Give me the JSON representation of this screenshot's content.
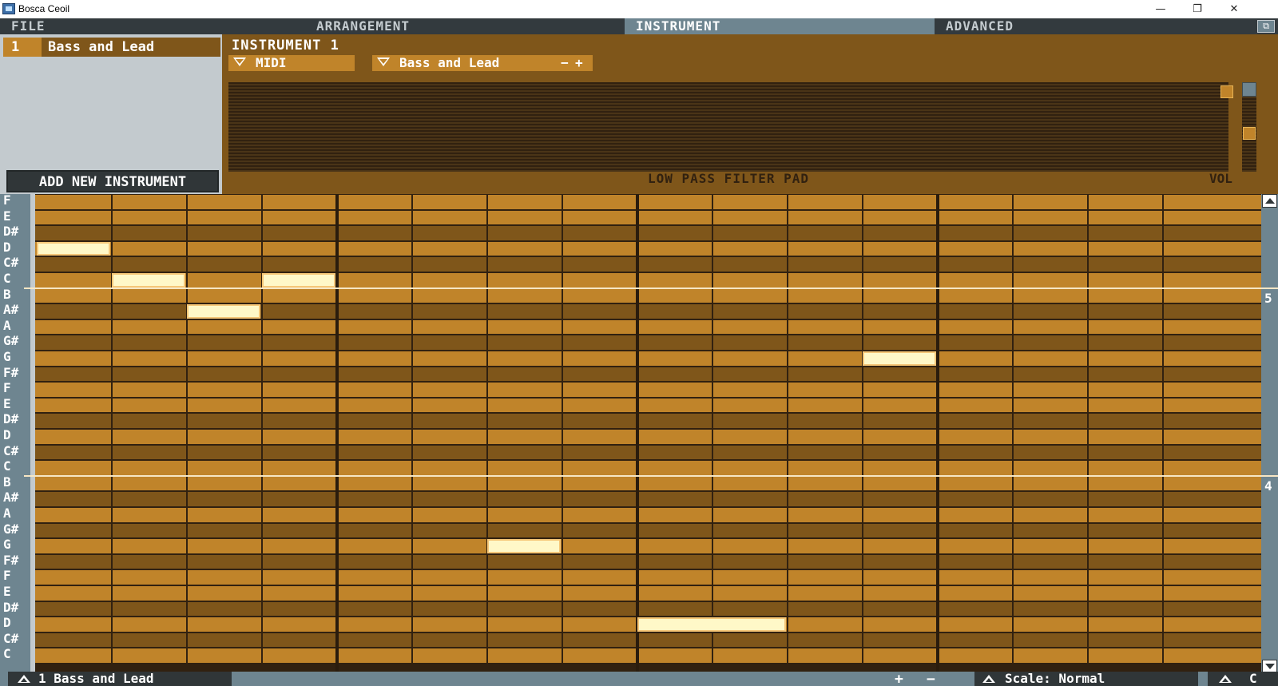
{
  "window": {
    "title": "Bosca Ceoil",
    "minimize": "—",
    "maximize": "❐",
    "close": "✕"
  },
  "menu": {
    "tabs": [
      {
        "label": "FILE",
        "active": false
      },
      {
        "label": "ARRANGEMENT",
        "active": false
      },
      {
        "label": "INSTRUMENT",
        "active": true
      },
      {
        "label": "ADVANCED",
        "active": false
      }
    ],
    "restore_icon": "⧉"
  },
  "instrument_list": {
    "items": [
      {
        "number": "1",
        "name": "Bass and Lead"
      }
    ],
    "add_button": "ADD NEW INSTRUMENT"
  },
  "instrument_panel": {
    "title": "INSTRUMENT 1",
    "type_dropdown": "MIDI",
    "preset_dropdown": "Bass and Lead",
    "minus": "−",
    "plus": "+",
    "filter_label": "LOW PASS FILTER PAD",
    "vol_label": "VOL"
  },
  "piano_roll": {
    "rows": [
      "F",
      "E",
      "D#",
      "D",
      "C#",
      "C",
      "B",
      "A#",
      "A",
      "G#",
      "G",
      "F#",
      "F",
      "E",
      "D#",
      "D",
      "C#",
      "C",
      "B",
      "A#",
      "A",
      "G#",
      "G",
      "F#",
      "F",
      "E",
      "D#",
      "D",
      "C#",
      "C"
    ],
    "sharp_rows_light": true,
    "octave_markers": [
      {
        "after_row": 5,
        "label": "5"
      },
      {
        "after_row": 17,
        "label": "4"
      }
    ],
    "columns": 16,
    "notes": [
      {
        "row": 3,
        "col": 0,
        "len": 1
      },
      {
        "row": 5,
        "col": 1,
        "len": 1
      },
      {
        "row": 5,
        "col": 3,
        "len": 1
      },
      {
        "row": 7,
        "col": 2,
        "len": 1
      },
      {
        "row": 10,
        "col": 11,
        "len": 1
      },
      {
        "row": 22,
        "col": 6,
        "len": 1
      },
      {
        "row": 27,
        "col": 8,
        "len": 2
      }
    ]
  },
  "status": {
    "instrument": "1  Bass and Lead",
    "plus": "+",
    "minus": "−",
    "scale": "Scale: Normal",
    "key": "C"
  },
  "colors": {
    "accent": "#c0842a",
    "dark_brown": "#7f561a",
    "slate": "#6e8590",
    "note": "#fff8c8"
  }
}
